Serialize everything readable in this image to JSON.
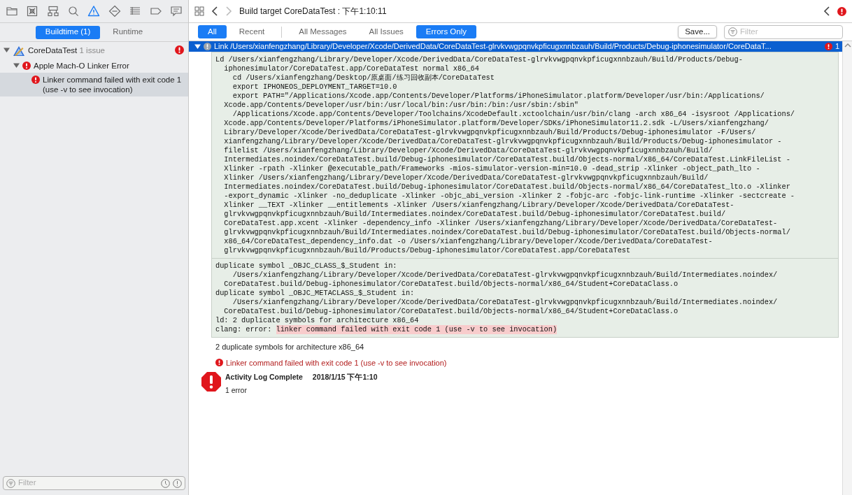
{
  "navigator": {
    "icons": [
      {
        "kind": "folder",
        "selected": false
      },
      {
        "kind": "box",
        "selected": false
      },
      {
        "kind": "hierarchy",
        "selected": false
      },
      {
        "kind": "search",
        "selected": false
      },
      {
        "kind": "warning",
        "selected": true
      },
      {
        "kind": "diamond",
        "selected": false
      },
      {
        "kind": "list",
        "selected": false
      },
      {
        "kind": "tag",
        "selected": false
      },
      {
        "kind": "chat",
        "selected": false
      }
    ],
    "tabs": [
      {
        "label": "Buildtime (1)",
        "selected": true
      },
      {
        "label": "Runtime",
        "selected": false
      }
    ],
    "tree": [
      {
        "label": "CoreDataTest",
        "note": "1 issue",
        "kind": "project",
        "expanded": true,
        "selected": false,
        "children": [
          {
            "label": "Apple Mach-O Linker Error",
            "kind": "error",
            "expanded": true,
            "selected": false,
            "children": [
              {
                "label": "Linker command failed with exit code 1 (use -v to see invocation)",
                "kind": "error",
                "selected": true
              }
            ]
          }
        ]
      }
    ],
    "filter": {
      "placeholder": "Filter"
    }
  },
  "jump_bar": {
    "back_disabled": false,
    "forward_disabled": true,
    "title": "Build target CoreDataTest : 下午1:10:11"
  },
  "scope_tabs": [
    {
      "label": "All",
      "selected": true
    },
    {
      "label": "Recent",
      "selected": false
    }
  ],
  "type_tabs": [
    {
      "label": "All Messages",
      "selected": false
    },
    {
      "label": "All Issues",
      "selected": false
    },
    {
      "label": "Errors Only",
      "selected": true
    }
  ],
  "save_button": "Save...",
  "filter": {
    "placeholder": "Filter"
  },
  "log_entry": {
    "title": "Link /Users/xianfengzhang/Library/Developer/Xcode/DerivedData/CoreDataTest-glrvkvwgpqnvkpficugxnnbzauh/Build/Products/Debug-iphonesimulator/CoreDataT...",
    "error_count": "1",
    "expanded": true,
    "command_lines": [
      "Ld /Users/xianfengzhang/Library/Developer/Xcode/DerivedData/CoreDataTest-glrvkvwgpqnvkpficugxnnbzauh/Build/Products/Debug-",
      "  iphonesimulator/CoreDataTest.app/CoreDataTest normal x86_64",
      "    cd /Users/xianfengzhang/Desktop/原桌面/练习回收副本/CoreDataTest",
      "    export IPHONEOS_DEPLOYMENT_TARGET=10.0",
      "    export PATH=\"/Applications/Xcode.app/Contents/Developer/Platforms/iPhoneSimulator.platform/Developer/usr/bin:/Applications/",
      "  Xcode.app/Contents/Developer/usr/bin:/usr/local/bin:/usr/bin:/bin:/usr/sbin:/sbin\"",
      "    /Applications/Xcode.app/Contents/Developer/Toolchains/XcodeDefault.xctoolchain/usr/bin/clang -arch x86_64 -isysroot /Applications/",
      "  Xcode.app/Contents/Developer/Platforms/iPhoneSimulator.platform/Developer/SDKs/iPhoneSimulator11.2.sdk -L/Users/xianfengzhang/",
      "  Library/Developer/Xcode/DerivedData/CoreDataTest-glrvkvwgpqnvkpficugxnnbzauh/Build/Products/Debug-iphonesimulator -F/Users/",
      "  xianfengzhang/Library/Developer/Xcode/DerivedData/CoreDataTest-glrvkvwgpqnvkpficugxnnbzauh/Build/Products/Debug-iphonesimulator -",
      "  filelist /Users/xianfengzhang/Library/Developer/Xcode/DerivedData/CoreDataTest-glrvkvwgpqnvkpficugxnnbzauh/Build/",
      "  Intermediates.noindex/CoreDataTest.build/Debug-iphonesimulator/CoreDataTest.build/Objects-normal/x86_64/CoreDataTest.LinkFileList -",
      "  Xlinker -rpath -Xlinker @executable_path/Frameworks -mios-simulator-version-min=10.0 -dead_strip -Xlinker -object_path_lto -",
      "  Xlinker /Users/xianfengzhang/Library/Developer/Xcode/DerivedData/CoreDataTest-glrvkvwgpqnvkpficugxnnbzauh/Build/",
      "  Intermediates.noindex/CoreDataTest.build/Debug-iphonesimulator/CoreDataTest.build/Objects-normal/x86_64/CoreDataTest_lto.o -Xlinker",
      "  -export_dynamic -Xlinker -no_deduplicate -Xlinker -objc_abi_version -Xlinker 2 -fobjc-arc -fobjc-link-runtime -Xlinker -sectcreate -",
      "  Xlinker __TEXT -Xlinker __entitlements -Xlinker /Users/xianfengzhang/Library/Developer/Xcode/DerivedData/CoreDataTest-",
      "  glrvkvwgpqnvkpficugxnnbzauh/Build/Intermediates.noindex/CoreDataTest.build/Debug-iphonesimulator/CoreDataTest.build/",
      "  CoreDataTest.app.xcent -Xlinker -dependency_info -Xlinker /Users/xianfengzhang/Library/Developer/Xcode/DerivedData/CoreDataTest-",
      "  glrvkvwgpqnvkpficugxnnbzauh/Build/Intermediates.noindex/CoreDataTest.build/Debug-iphonesimulator/CoreDataTest.build/Objects-normal/",
      "  x86_64/CoreDataTest_dependency_info.dat -o /Users/xianfengzhang/Library/Developer/Xcode/DerivedData/CoreDataTest-",
      "  glrvkvwgpqnvkpficugxnnbzauh/Build/Products/Debug-iphonesimulator/CoreDataTest.app/CoreDataTest"
    ],
    "output_lines": [
      "duplicate symbol _OBJC_CLASS_$_Student in:",
      "    /Users/xianfengzhang/Library/Developer/Xcode/DerivedData/CoreDataTest-glrvkvwgpqnvkpficugxnnbzauh/Build/Intermediates.noindex/",
      "  CoreDataTest.build/Debug-iphonesimulator/CoreDataTest.build/Objects-normal/x86_64/Student+CoreDataClass.o",
      "duplicate symbol _OBJC_METACLASS_$_Student in:",
      "    /Users/xianfengzhang/Library/Developer/Xcode/DerivedData/CoreDataTest-glrvkvwgpqnvkpficugxnnbzauh/Build/Intermediates.noindex/",
      "  CoreDataTest.build/Debug-iphonesimulator/CoreDataTest.build/Objects-normal/x86_64/Student+CoreDataClass.o",
      "ld: 2 duplicate symbols for architecture x86_64"
    ],
    "error_line": {
      "prefix": "clang: error: ",
      "message": "linker command failed with exit code 1 (use -v to see invocation)"
    },
    "summary": "2 duplicate symbols for architecture x86_64",
    "error_message": "Linker command failed with exit code 1 (use -v to see invocation)"
  },
  "completion": {
    "title": "Activity Log Complete",
    "time": "2018/1/15 下午1:10",
    "result": "1 error"
  }
}
